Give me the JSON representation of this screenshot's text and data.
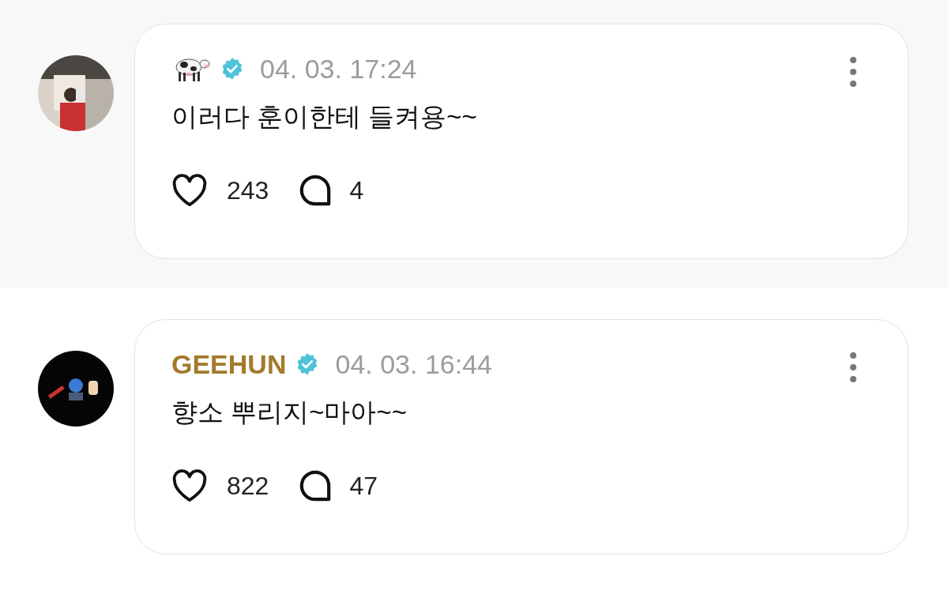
{
  "posts": [
    {
      "kind": "icon-name",
      "highlighted": true,
      "verified": true,
      "time": "04. 03. 17:24",
      "text": "이러다 훈이한테 들켜용~~",
      "likes": "243",
      "replies": "4"
    },
    {
      "kind": "text-name",
      "author": "GEEHUN",
      "highlighted": false,
      "verified": true,
      "time": "04. 03. 16:44",
      "text": "향소 뿌리지~마아~~",
      "likes": "822",
      "replies": "47"
    }
  ]
}
